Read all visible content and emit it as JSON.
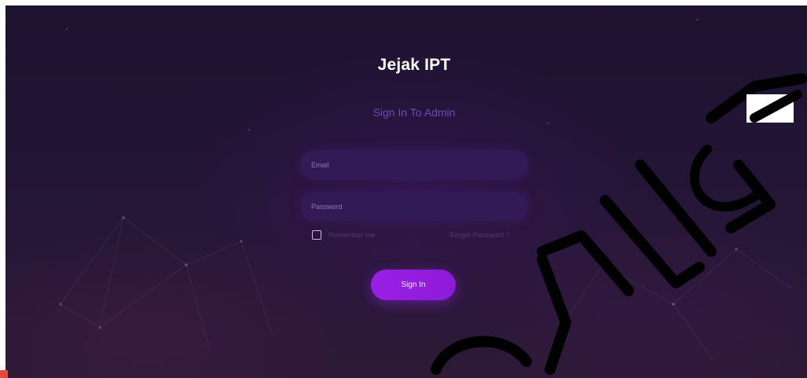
{
  "app": {
    "title": "Jejak IPT",
    "subtitle": "Sign In To Admin"
  },
  "form": {
    "email_placeholder": "Email",
    "password_placeholder": "Password",
    "remember_label": "Remember me",
    "forgot_label": "Forget Password ?",
    "signin_label": "Sign In"
  },
  "colors": {
    "accent": "#9a1fe6",
    "background": "#231536",
    "subtitle": "#6b4fb0"
  }
}
